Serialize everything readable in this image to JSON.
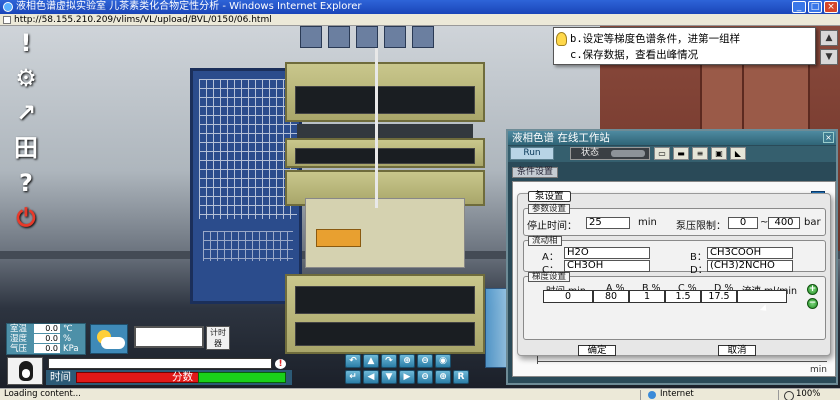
{
  "browser": {
    "title": "液相色谱虚拟实验室 儿茶素类化合物定性分析 - Windows Internet Explorer",
    "url": "http://58.155.210.209/vlims/VL/upload/BVL/0150/06.html",
    "status_text": "Loading content...",
    "zone": "Internet",
    "zoom": "100%"
  },
  "hint": {
    "line1": "b.设定等梯度色谱条件，进第一组样",
    "line2": "c.保存数据，查看出峰情况"
  },
  "workstation": {
    "title": "液相色谱 在线工作站",
    "run_label": "Run",
    "status_label": "状态",
    "conditions_tab": "条件设置",
    "axis_unit": "min",
    "close": "×"
  },
  "pump_dialog": {
    "title": "泵设置",
    "params_section": "参数设置",
    "stop_time_label": "停止时间：",
    "stop_time_value": "25",
    "stop_time_unit": "min",
    "pressure_limit_label": "泵压限制：",
    "pressure_min": "0",
    "pressure_tilde": "~",
    "pressure_max": "400",
    "pressure_unit": "bar",
    "mobile_phase_section": "流动相",
    "solvents": [
      {
        "label": "A：",
        "value": "H2O"
      },
      {
        "label": "B：",
        "value": "CH3COOH"
      },
      {
        "label": "C：",
        "value": "CH3OH"
      },
      {
        "label": "D：",
        "value": "(CH3)2NCHO"
      }
    ],
    "gradient_section": "梯度设置",
    "gradient_headers": [
      "时间 min",
      "A %",
      "B %",
      "C %",
      "D %",
      "流速 ml/min"
    ],
    "gradient_row": [
      "0",
      "80",
      "1",
      "1.5",
      "17.5",
      ""
    ],
    "ok_label": "确定",
    "cancel_label": "取消"
  },
  "env": {
    "rows": [
      {
        "label": "室温",
        "value": "0.0",
        "unit": "℃"
      },
      {
        "label": "湿度",
        "value": "0.0",
        "unit": "%"
      },
      {
        "label": "气压",
        "value": "0.0",
        "unit": "KPa"
      }
    ],
    "timer_label_1": "计时",
    "timer_label_2": "器"
  },
  "bottom": {
    "time_label": "时间",
    "score_label": "分数",
    "alert_glyph": "!"
  },
  "left_toolbar": [
    "!",
    "⚙",
    "↗",
    "田",
    "?",
    "⏻"
  ],
  "camera_controls": [
    "↶",
    "▲",
    "↷",
    "⊕",
    "⊖",
    "◉",
    "",
    "↵",
    "◀",
    "▼",
    "▶",
    "⊖",
    "⊕",
    "R"
  ],
  "colors": {
    "time_bar": "#e01818",
    "score_bar": "#1ad01a",
    "run_button": "#b8d4e6",
    "accent": "#2c5a76"
  }
}
